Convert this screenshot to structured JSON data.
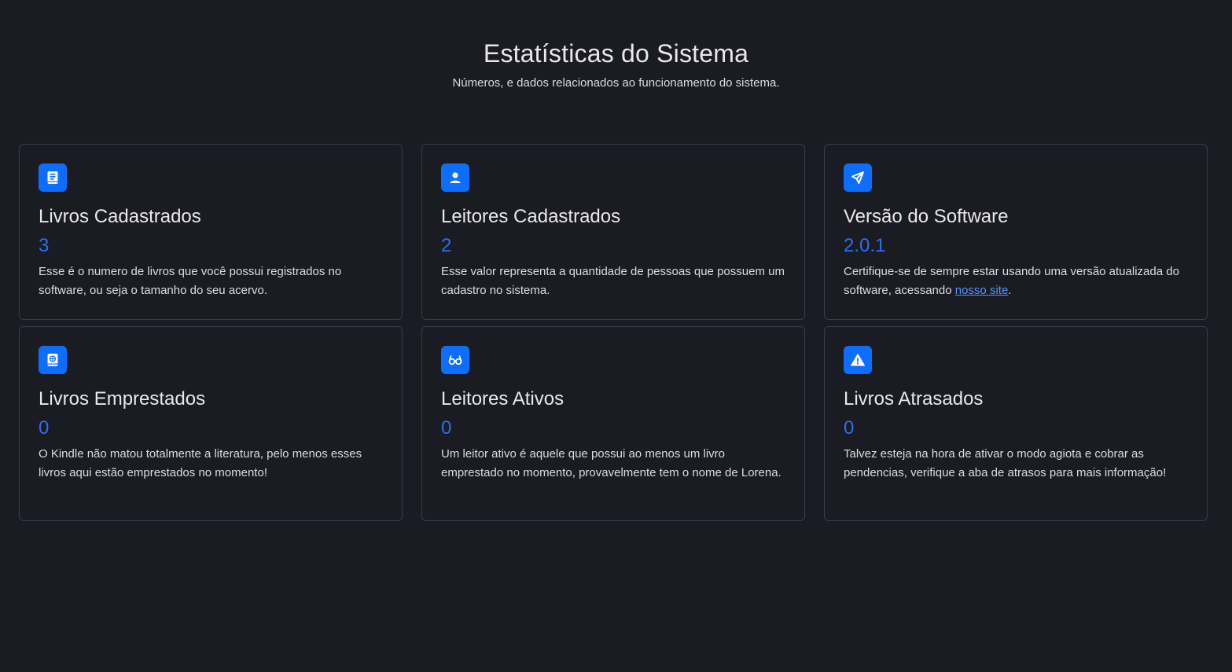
{
  "header": {
    "title": "Estatísticas do Sistema",
    "subtitle": "Números, e dados relacionados ao funcionamento do sistema."
  },
  "colors": {
    "background": "#1a1b23",
    "accent": "#0d6efd",
    "value": "#2f6ef0",
    "border": "#3a3c47",
    "link": "#5b93ff"
  },
  "cards": [
    {
      "icon": "book-icon",
      "title": "Livros Cadastrados",
      "value": "3",
      "description": "Esse é o numero de livros que você possui registrados no software, ou seja o tamanho do seu acervo."
    },
    {
      "icon": "person-icon",
      "title": "Leitores Cadastrados",
      "value": "2",
      "description": "Esse valor representa a quantidade de pessoas que possuem um cadastro no sistema."
    },
    {
      "icon": "send-icon",
      "title": "Versão do Software",
      "value": "2.0.1",
      "description_before": "Certifique-se de sempre estar usando uma versão atualizada do software, acessando ",
      "link_text": "nosso site",
      "description_after": "."
    },
    {
      "icon": "journal-globe-icon",
      "title": "Livros Emprestados",
      "value": "0",
      "description": "O Kindle não matou totalmente a literatura, pelo menos esses livros aqui estão emprestados no momento!"
    },
    {
      "icon": "eyeglasses-icon",
      "title": "Leitores Ativos",
      "value": "0",
      "description": "Um leitor ativo é aquele que possui ao menos um livro emprestado no momento, provavelmente tem o nome de Lorena."
    },
    {
      "icon": "warning-icon",
      "title": "Livros Atrasados",
      "value": "0",
      "description": "Talvez esteja na hora de ativar o modo agiota e cobrar as pendencias, verifique a aba de atrasos para mais informação!"
    }
  ]
}
